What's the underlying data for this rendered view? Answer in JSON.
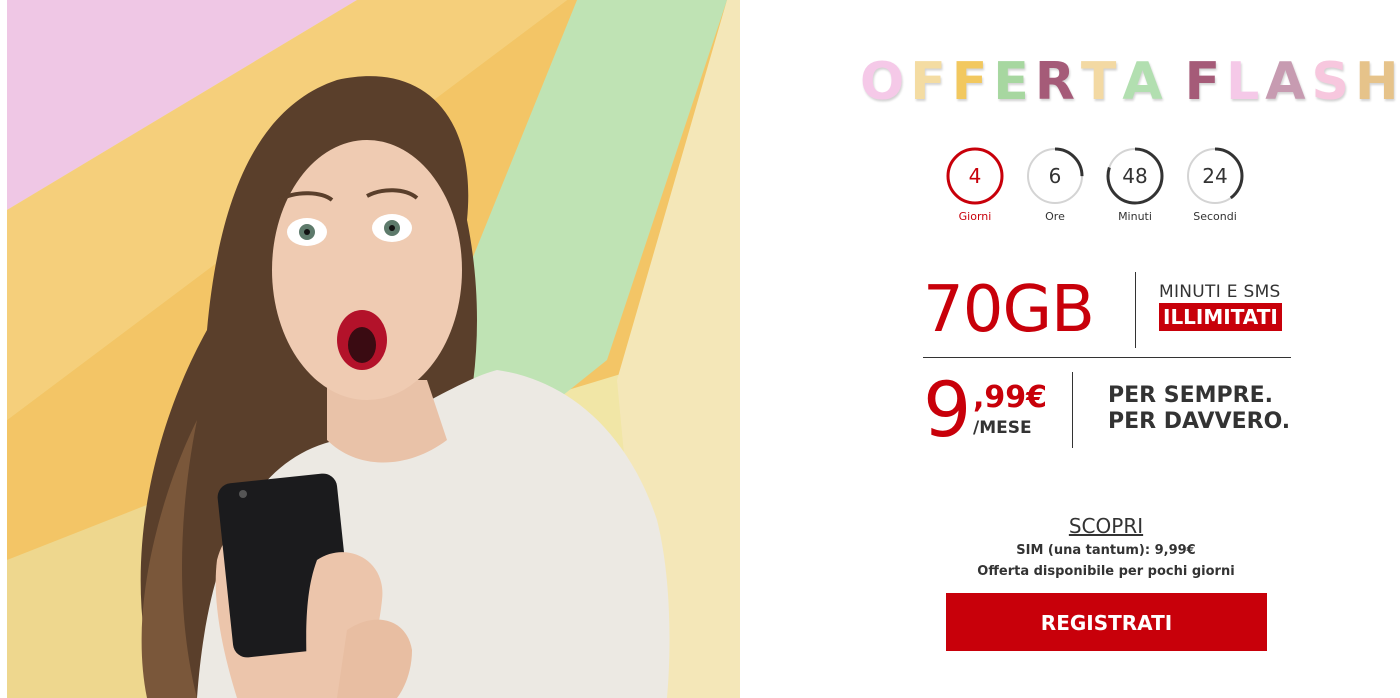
{
  "hero": {
    "image_alt": "surprised-woman-holding-phone"
  },
  "offer": {
    "title_letters": [
      {
        "char": "O",
        "color": "#f5c9e8"
      },
      {
        "char": "F",
        "color": "#f4dca2"
      },
      {
        "char": "F",
        "color": "#f2c85f"
      },
      {
        "char": "E",
        "color": "#a7d7a0"
      },
      {
        "char": "R",
        "color": "#a55b78"
      },
      {
        "char": "T",
        "color": "#f3d9a3"
      },
      {
        "char": "A",
        "color": "#b2dfb0"
      },
      {
        "char": " ",
        "color": "#ffffff"
      },
      {
        "char": "F",
        "color": "#a55b78"
      },
      {
        "char": "L",
        "color": "#f5c9e8"
      },
      {
        "char": "A",
        "color": "#c79bb1"
      },
      {
        "char": "S",
        "color": "#f7c7de"
      },
      {
        "char": "H",
        "color": "#e6c38a"
      }
    ],
    "countdown": [
      {
        "value": "4",
        "label": "Giorni",
        "progress": 1.0,
        "color": "#c8000a"
      },
      {
        "value": "6",
        "label": "Ore",
        "progress": 0.25,
        "color": "#333333"
      },
      {
        "value": "48",
        "label": "Minuti",
        "progress": 0.8,
        "color": "#333333"
      },
      {
        "value": "24",
        "label": "Secondi",
        "progress": 0.4,
        "color": "#333333"
      }
    ],
    "data_amount": "70GB",
    "minutes_sms": "MINUTI E SMS",
    "unlimited": "ILLIMITATI",
    "price_integer": "9",
    "price_decimal": ",99€",
    "per_month": "/MESE",
    "forever_line1": "PER SEMPRE.",
    "forever_line2": "PER DAVVERO.",
    "discover_link": "SCOPRI",
    "sim_fee": "SIM (una tantum): 9,99€",
    "availability": "Offerta disponibile per pochi giorni",
    "register_button": "REGISTRATI"
  },
  "colors": {
    "accent": "#c8000a",
    "text": "#333333"
  }
}
